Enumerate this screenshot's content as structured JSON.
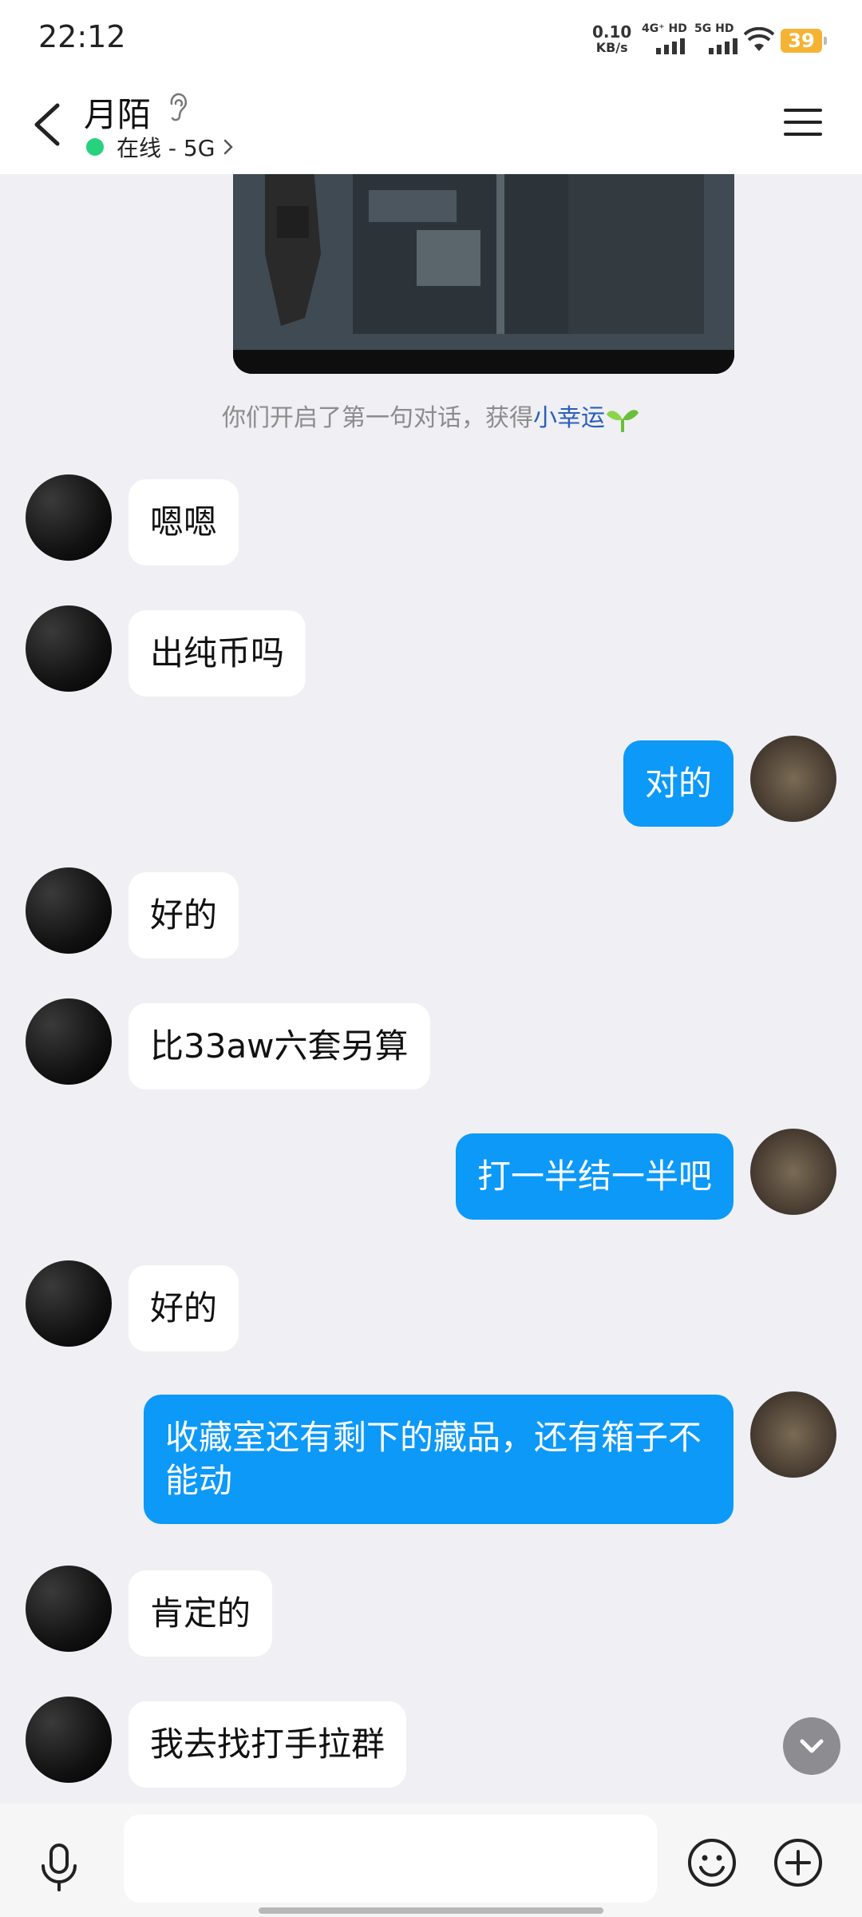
{
  "status_bar": {
    "time": "22:12",
    "net_speed_value": "0.10",
    "net_speed_unit": "KB/s",
    "sim1_label": "4G⁺ HD",
    "sim2_label": "5G HD",
    "battery": "39",
    "battery_color": "#f4b334"
  },
  "header": {
    "title": "月陌",
    "status": "在线 - 5G",
    "online_color": "#27d17e"
  },
  "system_note": {
    "text": "你们开启了第一句对话，获得",
    "highlight": "小幸运"
  },
  "messages": [
    {
      "side": "in",
      "text": "嗯嗯"
    },
    {
      "side": "in",
      "text": "出纯币吗"
    },
    {
      "side": "out",
      "text": "对的"
    },
    {
      "side": "in",
      "text": "好的"
    },
    {
      "side": "in",
      "text": "比33aw六套另算"
    },
    {
      "side": "out",
      "text": "打一半结一半吧"
    },
    {
      "side": "in",
      "text": "好的"
    },
    {
      "side": "out",
      "text": "收藏室还有剩下的藏品，还有箱子不能动"
    },
    {
      "side": "in",
      "text": "肯定的"
    },
    {
      "side": "in",
      "text": "我去找打手拉群"
    }
  ],
  "input": {
    "value": "",
    "placeholder": ""
  },
  "colors": {
    "outgoing_bubble": "#0c99f8",
    "incoming_bubble": "#ffffff",
    "background": "#efeff4"
  },
  "icons": [
    "back-arrow-icon",
    "ear-icon",
    "menu-icon",
    "sprout-icon",
    "chevron-down-icon",
    "microphone-icon",
    "emoji-icon",
    "plus-icon"
  ]
}
